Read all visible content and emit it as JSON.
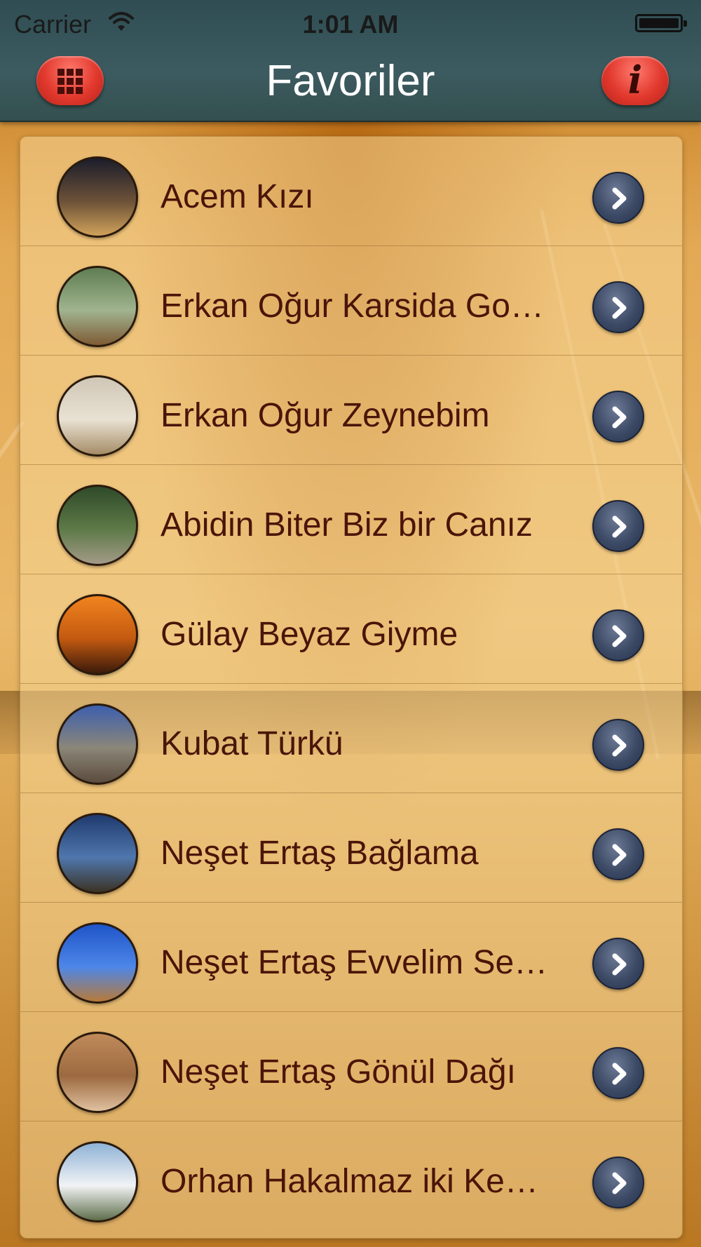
{
  "status_bar": {
    "carrier": "Carrier",
    "time": "1:01 AM"
  },
  "nav": {
    "title": "Favoriler",
    "left_button_icon": "grid-icon",
    "right_button_icon": "info-icon",
    "right_button_glyph": "i"
  },
  "favorites": {
    "items": [
      {
        "title": "Acem Kızı",
        "thumb_colors": [
          "#1b1d2a",
          "#6c5138",
          "#d0a15a"
        ]
      },
      {
        "title": "Erkan Oğur Karsida Go…",
        "thumb_colors": [
          "#5f7d52",
          "#a0b48f",
          "#7e5b35"
        ]
      },
      {
        "title": "Erkan Oğur Zeynebim",
        "thumb_colors": [
          "#cfc6b6",
          "#e9e1d2",
          "#a58c66"
        ]
      },
      {
        "title": "Abidin Biter Biz bir Canız",
        "thumb_colors": [
          "#2f4a2a",
          "#5d7a47",
          "#a49a88"
        ]
      },
      {
        "title": "Gülay Beyaz Giyme",
        "thumb_colors": [
          "#f1831e",
          "#c35a10",
          "#3b1a0a"
        ]
      },
      {
        "title": "Kubat Türkü",
        "thumb_colors": [
          "#3d5fae",
          "#8b8678",
          "#5b4c3e"
        ]
      },
      {
        "title": "Neşet Ertaş Bağlama",
        "thumb_colors": [
          "#1f3a6e",
          "#4f77ad",
          "#3b3325"
        ]
      },
      {
        "title": "Neşet Ertaş Evvelim Se…",
        "thumb_colors": [
          "#1f55c8",
          "#4d86e8",
          "#b77a3a"
        ]
      },
      {
        "title": "Neşet Ertaş Gönül Dağı",
        "thumb_colors": [
          "#c08a5a",
          "#9c6a40",
          "#e0c1a0"
        ]
      },
      {
        "title": "Orhan Hakalmaz iki Ke…",
        "thumb_colors": [
          "#8fb2d6",
          "#f1f3f5",
          "#5e6e4a"
        ]
      }
    ],
    "row_action_icon": "chevron-right-icon"
  },
  "colors": {
    "nav_bar": "#3c5b60",
    "nav_button": "#e2392e",
    "row_text": "#4a1508",
    "chevron_button": "#3c4a66"
  }
}
